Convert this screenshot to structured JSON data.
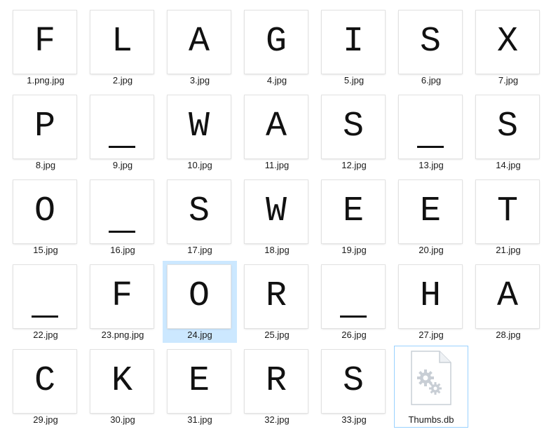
{
  "files": [
    {
      "label": "1.png.jpg",
      "glyph": "F"
    },
    {
      "label": "2.jpg",
      "glyph": "L"
    },
    {
      "label": "3.jpg",
      "glyph": "A"
    },
    {
      "label": "4.jpg",
      "glyph": "G"
    },
    {
      "label": "5.jpg",
      "glyph": "I"
    },
    {
      "label": "6.jpg",
      "glyph": "S"
    },
    {
      "label": "7.jpg",
      "glyph": "X"
    },
    {
      "label": "8.jpg",
      "glyph": "P"
    },
    {
      "label": "9.jpg",
      "glyph": "_"
    },
    {
      "label": "10.jpg",
      "glyph": "W"
    },
    {
      "label": "11.jpg",
      "glyph": "A"
    },
    {
      "label": "12.jpg",
      "glyph": "S"
    },
    {
      "label": "13.jpg",
      "glyph": "_"
    },
    {
      "label": "14.jpg",
      "glyph": "S"
    },
    {
      "label": "15.jpg",
      "glyph": "O"
    },
    {
      "label": "16.jpg",
      "glyph": "_"
    },
    {
      "label": "17.jpg",
      "glyph": "S"
    },
    {
      "label": "18.jpg",
      "glyph": "W"
    },
    {
      "label": "19.jpg",
      "glyph": "E"
    },
    {
      "label": "20.jpg",
      "glyph": "E"
    },
    {
      "label": "21.jpg",
      "glyph": "T"
    },
    {
      "label": "22.jpg",
      "glyph": "_"
    },
    {
      "label": "23.png.jpg",
      "glyph": "F"
    },
    {
      "label": "24.jpg",
      "glyph": "O",
      "selected": true
    },
    {
      "label": "25.jpg",
      "glyph": "R"
    },
    {
      "label": "26.jpg",
      "glyph": "_"
    },
    {
      "label": "27.jpg",
      "glyph": "H"
    },
    {
      "label": "28.jpg",
      "glyph": "A"
    },
    {
      "label": "29.jpg",
      "glyph": "C"
    },
    {
      "label": "30.jpg",
      "glyph": "K"
    },
    {
      "label": "31.jpg",
      "glyph": "E"
    },
    {
      "label": "32.jpg",
      "glyph": "R"
    },
    {
      "label": "33.jpg",
      "glyph": "S"
    },
    {
      "label": "Thumbs.db",
      "icon": "settings-file-icon",
      "focused": true
    }
  ],
  "colors": {
    "selection": "#cce8ff",
    "focus_border": "#99d1ff"
  }
}
